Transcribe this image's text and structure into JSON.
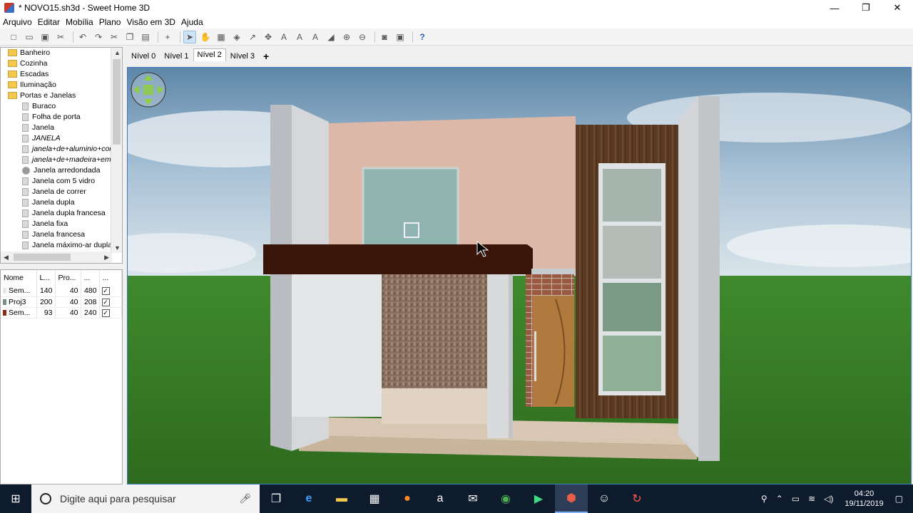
{
  "window": {
    "title": "* NOVO15.sh3d - Sweet Home 3D",
    "minimize": "—",
    "maximize": "❐",
    "close": "✕"
  },
  "menu": [
    "Arquivo",
    "Editar",
    "Mobília",
    "Plano",
    "Visão em 3D",
    "Ajuda"
  ],
  "catalog": {
    "items": [
      {
        "label": "Banheiro",
        "type": "folder"
      },
      {
        "label": "Cozinha",
        "type": "folder"
      },
      {
        "label": "Escadas",
        "type": "folder"
      },
      {
        "label": "Iluminação",
        "type": "folder"
      },
      {
        "label": "Portas e Janelas",
        "type": "folder"
      },
      {
        "label": "Buraco",
        "type": "leaf"
      },
      {
        "label": "Folha de porta",
        "type": "leaf"
      },
      {
        "label": "Janela",
        "type": "leaf"
      },
      {
        "label": "JANELA",
        "type": "leaf",
        "italic": true
      },
      {
        "label": "janela+de+aluminio+cor",
        "type": "leaf",
        "italic": true
      },
      {
        "label": "janela+de+madeira+em",
        "type": "leaf",
        "italic": true
      },
      {
        "label": "Janela arredondada",
        "type": "leaf",
        "round": true
      },
      {
        "label": "Janela com 5 vidro",
        "type": "leaf"
      },
      {
        "label": "Janela de correr",
        "type": "leaf"
      },
      {
        "label": "Janela dupla",
        "type": "leaf"
      },
      {
        "label": "Janela dupla francesa",
        "type": "leaf"
      },
      {
        "label": "Janela fixa",
        "type": "leaf"
      },
      {
        "label": "Janela francesa",
        "type": "leaf"
      },
      {
        "label": "Janela máximo-ar dupla",
        "type": "leaf"
      }
    ]
  },
  "furniture": {
    "headers": [
      "Nome",
      "L...",
      "Pro...",
      "...",
      "..."
    ],
    "rows": [
      {
        "name": "Sem...",
        "w": "140",
        "d": "40",
        "h": "480",
        "visible": "✓",
        "color": "#e8e8e8"
      },
      {
        "name": "Proj3",
        "w": "200",
        "d": "40",
        "h": "208",
        "visible": "✓",
        "color": "#7b8c8c"
      },
      {
        "name": "Sem...",
        "w": "93",
        "d": "40",
        "h": "240",
        "visible": "✓",
        "color": "#8b2a1a"
      }
    ]
  },
  "levels": {
    "tabs": [
      "Nível 0",
      "Nível 1",
      "Nível 2",
      "Nível 3"
    ],
    "active": "Nível 2",
    "add": "+"
  },
  "taskbar": {
    "search_placeholder": "Digite aqui para pesquisar",
    "time": "04:20",
    "date": "19/11/2019"
  },
  "colors": {
    "view_border": "#3c78c3",
    "active_tab": "#ffffff"
  }
}
